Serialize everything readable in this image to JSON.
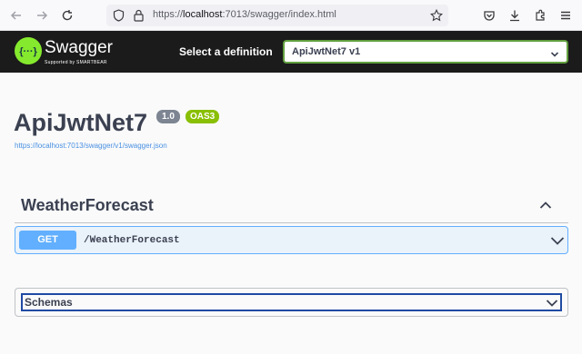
{
  "browser": {
    "url_scheme": "https://",
    "url_host": "localhost",
    "url_rest": ":7013/swagger/index.html",
    "icons": [
      "back-icon",
      "forward-icon",
      "reload-icon",
      "shield-icon",
      "lock-icon",
      "star-icon",
      "pocket-icon",
      "download-icon",
      "extensions-icon",
      "menu-icon"
    ]
  },
  "topbar": {
    "logo_title": "Swagger",
    "logo_sub": "Supported by SMARTBEAR",
    "definition_label": "Select a definition",
    "definition_value": "ApiJwtNet7 v1",
    "accent": "#85ea2d"
  },
  "info": {
    "title": "ApiJwtNet7",
    "version": "1.0",
    "oas": "OAS3",
    "spec_url": "https://localhost:7013/swagger/v1/swagger.json"
  },
  "tag": {
    "name": "WeatherForecast",
    "operations": [
      {
        "method": "GET",
        "path": "/WeatherForecast",
        "color": "#61affe"
      }
    ]
  },
  "schemas": {
    "label": "Schemas"
  }
}
